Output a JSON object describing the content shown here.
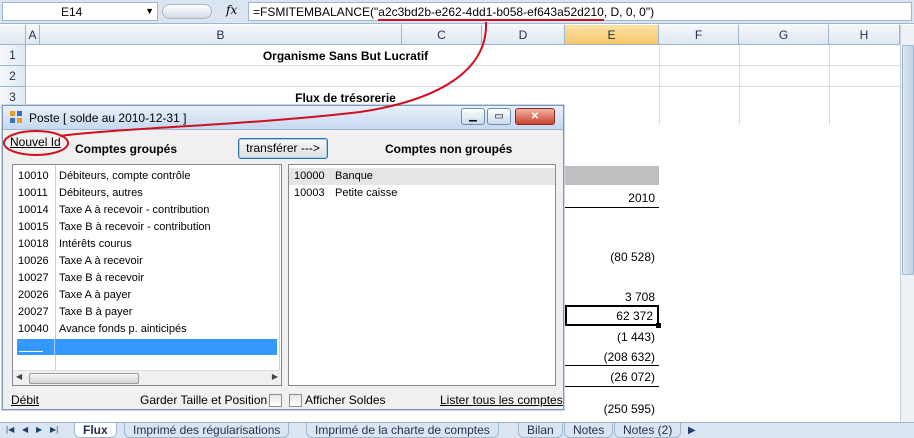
{
  "formula_bar": {
    "name_box": "E14",
    "fx": "fx",
    "formula_prefix": "=FSMITEMBALANCE(\"",
    "formula_id": "a2c3bd2b-e262-4dd1-b058-ef643a52d210",
    "formula_suffix": ", D, 0, 0\")"
  },
  "columns": [
    "A",
    "B",
    "C",
    "D",
    "E",
    "F",
    "G",
    "H"
  ],
  "rows": [
    "1",
    "2",
    "3"
  ],
  "sheet": {
    "title1": "Organisme Sans But Lucratif",
    "title3": "Flux de trésorerie",
    "e_cells": [
      "2010",
      "(80 528)",
      "3 708",
      "62 372",
      "(1 443)",
      "(208 632)",
      "(26 072)",
      "(250 595)"
    ]
  },
  "dialog": {
    "title": "Poste  [ solde au 2010-12-31 ]",
    "new_id": "Nouvel Id",
    "grouped_header": "Comptes groupés",
    "transfer_button": "transférer --->",
    "ungrouped_header": "Comptes non groupés",
    "grouped": [
      {
        "code": "10010",
        "label": "Débiteurs, compte contrôle"
      },
      {
        "code": "10011",
        "label": "Débiteurs, autres"
      },
      {
        "code": "10014",
        "label": "Taxe A à recevoir - contribution"
      },
      {
        "code": "10015",
        "label": "Taxe B à recevoir - contribution"
      },
      {
        "code": "10018",
        "label": "Intérêts courus"
      },
      {
        "code": "10026",
        "label": "Taxe A à recevoir"
      },
      {
        "code": "10027",
        "label": "Taxe B à recevoir"
      },
      {
        "code": "20026",
        "label": "Taxe A à payer"
      },
      {
        "code": "20027",
        "label": "Taxe B à payer"
      },
      {
        "code": "10040",
        "label": "Avance fonds p. ainticipés"
      }
    ],
    "ungrouped": [
      {
        "code": "10000",
        "label": "Banque"
      },
      {
        "code": "10003",
        "label": "Petite caisse"
      }
    ],
    "debit_link": "Débit",
    "keep_size_label": "Garder Taille et Position",
    "show_balances_label": "Afficher Soldes",
    "list_all_link": "Lister tous les comptes"
  },
  "tabs": [
    {
      "label": "Flux",
      "active": true
    },
    {
      "label": "Imprimé des régularisations"
    },
    {
      "label": "Imprimé de la charte de comptes"
    },
    {
      "label": "Bilan"
    },
    {
      "label": "Notes"
    },
    {
      "label": "Notes (2)"
    }
  ],
  "colors": {
    "annotation": "#d01020",
    "selection": "#3399ff",
    "selected_column": "#f5c56a"
  }
}
